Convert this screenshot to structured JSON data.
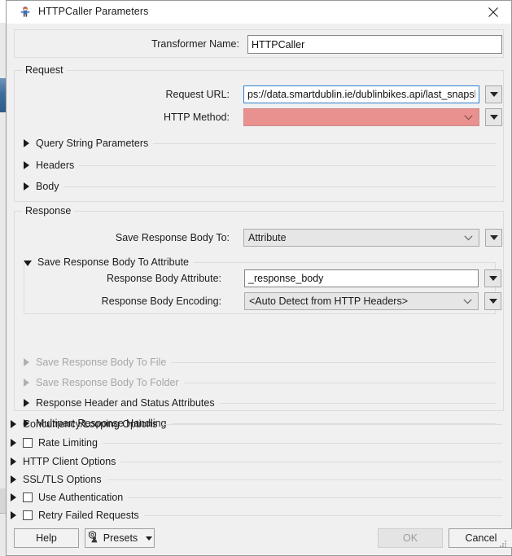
{
  "window": {
    "title": "HTTPCaller Parameters",
    "icon": "transformer-icon",
    "close_label": "✕"
  },
  "transformer": {
    "label": "Transformer Name:",
    "value": "HTTPCaller"
  },
  "request": {
    "title": "Request",
    "url": {
      "label": "Request URL:",
      "value": "ps://data.smartdublin.ie/dublinbikes.api/last_snapshot"
    },
    "method": {
      "label": "HTTP Method:",
      "value": "",
      "error_color": "#e8918f"
    },
    "sections": [
      {
        "label": "Query String Parameters",
        "expanded": false,
        "disabled": false,
        "checkbox": false
      },
      {
        "label": "Headers",
        "expanded": false,
        "disabled": false,
        "checkbox": false
      },
      {
        "label": "Body",
        "expanded": false,
        "disabled": false,
        "checkbox": false
      }
    ]
  },
  "response": {
    "title": "Response",
    "save_body_to": {
      "label": "Save Response Body To:",
      "value": "Attribute"
    },
    "attribute_group": {
      "title": "Save Response Body To Attribute",
      "expanded": true,
      "body_attribute": {
        "label": "Response Body Attribute:",
        "value": "_response_body"
      },
      "body_encoding": {
        "label": "Response Body Encoding:",
        "value": "<Auto Detect from HTTP Headers>"
      }
    },
    "sections": [
      {
        "label": "Save Response Body To File",
        "expanded": false,
        "disabled": true,
        "checkbox": false
      },
      {
        "label": "Save Response Body To Folder",
        "expanded": false,
        "disabled": true,
        "checkbox": false
      },
      {
        "label": "Response Header and Status Attributes",
        "expanded": false,
        "disabled": false,
        "checkbox": false
      },
      {
        "label": "Multipart Response Handling",
        "expanded": false,
        "disabled": false,
        "checkbox": false
      }
    ]
  },
  "root_sections": [
    {
      "label": "Concurrency/Looping Options",
      "expanded": false,
      "disabled": false,
      "checkbox": false
    },
    {
      "label": "Rate Limiting",
      "expanded": false,
      "disabled": false,
      "checkbox": true,
      "checked": false
    },
    {
      "label": "HTTP Client Options",
      "expanded": false,
      "disabled": false,
      "checkbox": false
    },
    {
      "label": "SSL/TLS Options",
      "expanded": false,
      "disabled": false,
      "checkbox": false
    },
    {
      "label": "Use Authentication",
      "expanded": false,
      "disabled": false,
      "checkbox": true,
      "checked": false
    },
    {
      "label": "Retry Failed Requests",
      "expanded": false,
      "disabled": false,
      "checkbox": true,
      "checked": false
    }
  ],
  "footer": {
    "help_label": "Help",
    "presets_label": "Presets",
    "ok_label": "OK",
    "ok_disabled": true,
    "cancel_label": "Cancel"
  }
}
